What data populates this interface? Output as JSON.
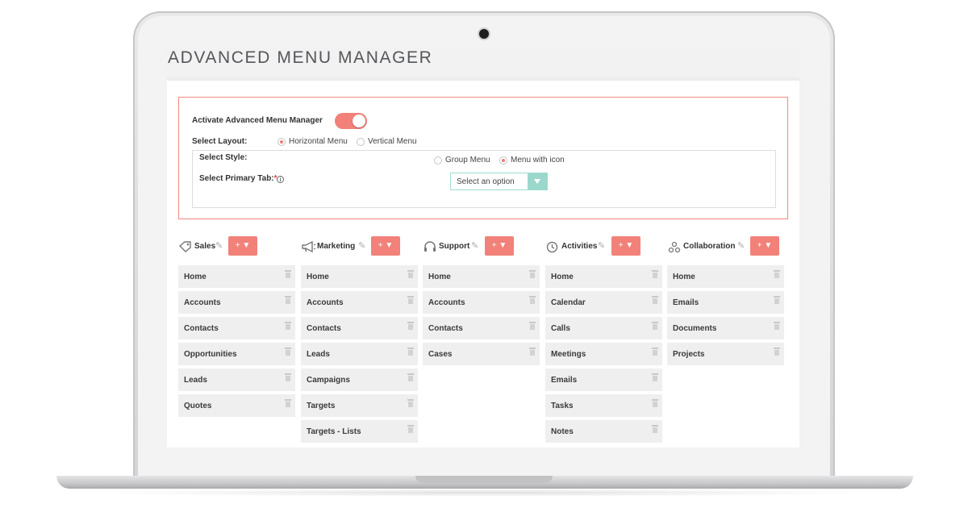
{
  "page": {
    "title": "ADVANCED MENU MANAGER"
  },
  "settings": {
    "activate_label": "Activate Advanced Menu Manager",
    "activate_on": true,
    "layout_label": "Select Layout:",
    "layout_options": [
      "Horizontal Menu",
      "Vertical Menu"
    ],
    "layout_selected": "Horizontal Menu",
    "style_label": "Select Style:",
    "style_options": [
      "Group Menu",
      "Menu with icon"
    ],
    "style_selected": "Menu with icon",
    "primary_tab_label": "Select Primary Tab:",
    "required_mark": "*",
    "info_glyph": "i",
    "select_placeholder": "Select an option"
  },
  "columns": [
    {
      "title": "Sales",
      "icon": "tag-icon",
      "add_label": "+ ▼",
      "items": [
        "Home",
        "Accounts",
        "Contacts",
        "Opportunities",
        "Leads",
        "Quotes"
      ]
    },
    {
      "title": "Marketing",
      "icon": "megaphone-icon",
      "add_label": "+ ▼",
      "items": [
        "Home",
        "Accounts",
        "Contacts",
        "Leads",
        "Campaigns",
        "Targets",
        "Targets - Lists"
      ]
    },
    {
      "title": "Support",
      "icon": "headset-icon",
      "add_label": "+ ▼",
      "items": [
        "Home",
        "Accounts",
        "Contacts",
        "Cases"
      ]
    },
    {
      "title": "Activities",
      "icon": "clock-icon",
      "add_label": "+ ▼",
      "items": [
        "Home",
        "Calendar",
        "Calls",
        "Meetings",
        "Emails",
        "Tasks",
        "Notes"
      ]
    },
    {
      "title": "Collaboration",
      "icon": "people-icon",
      "add_label": "+ ▼",
      "items": [
        "Home",
        "Emails",
        "Documents",
        "Projects"
      ]
    }
  ],
  "colors": {
    "accent": "#f28179",
    "select_accent": "#9ad8cc",
    "item_bg": "#efefef"
  }
}
